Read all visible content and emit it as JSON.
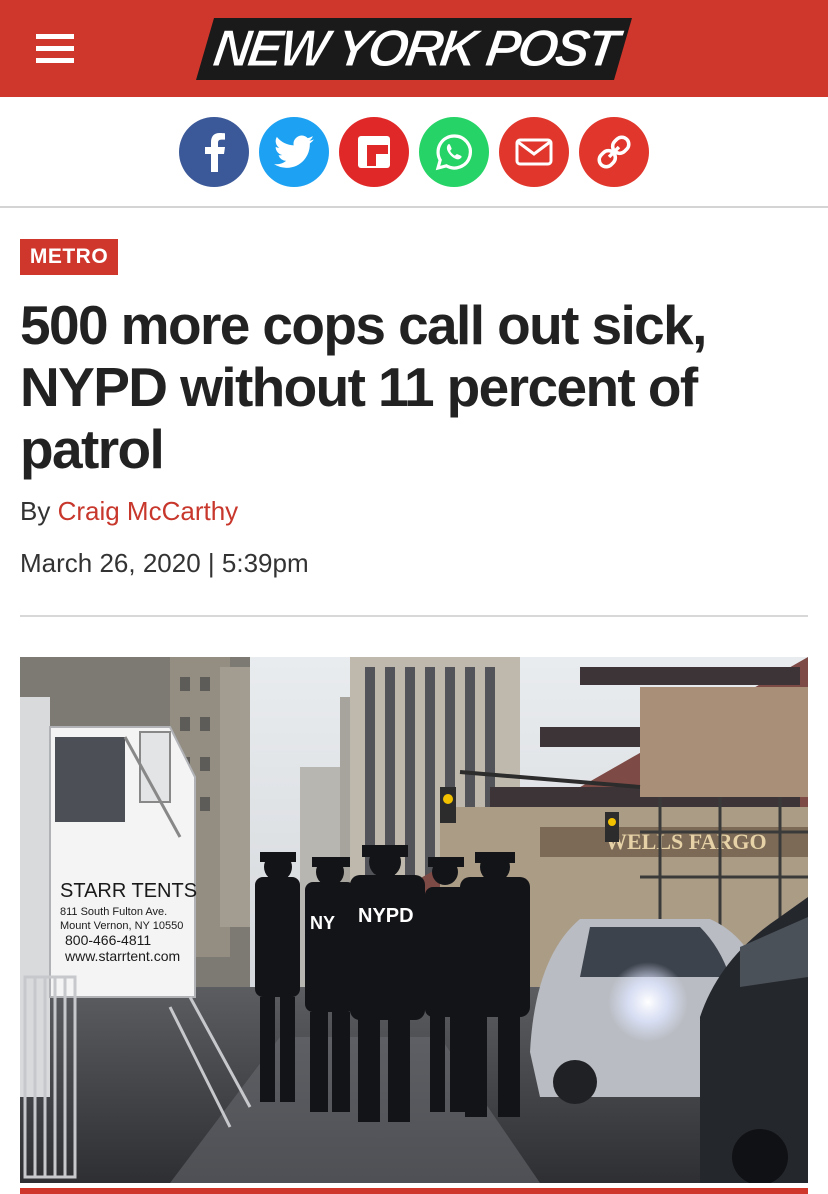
{
  "header": {
    "logo_text": "NEW YORK POST",
    "menu_icon": "hamburger-menu-icon",
    "brand_color": "#d0372c"
  },
  "share": [
    {
      "icon": "facebook-icon",
      "color": "#3b5998"
    },
    {
      "icon": "twitter-icon",
      "color": "#1da1f2"
    },
    {
      "icon": "flipboard-icon",
      "color": "#e12828"
    },
    {
      "icon": "whatsapp-icon",
      "color": "#25d366"
    },
    {
      "icon": "email-icon",
      "color": "#e0362c"
    },
    {
      "icon": "link-icon",
      "color": "#e0362c"
    }
  ],
  "article": {
    "section": "METRO",
    "headline": "500 more cops call out sick, NYPD without 11 percent of patrol",
    "byline_prefix": "By",
    "author": "Craig McCarthy",
    "date": "March 26, 2020",
    "time": "5:39pm",
    "date_separator": "|"
  },
  "photo": {
    "truck_sign_title": "STARR TENTS",
    "truck_sign_address1": "811 South Fulton Ave.",
    "truck_sign_address2": "Mount Vernon, NY 10550",
    "truck_sign_phone": "800-466-4811",
    "truck_sign_web": "www.starrtent.com",
    "jacket_text_1": "NYPD",
    "jacket_text_2": "NY",
    "bank_sign": "WELLS FARGO"
  }
}
